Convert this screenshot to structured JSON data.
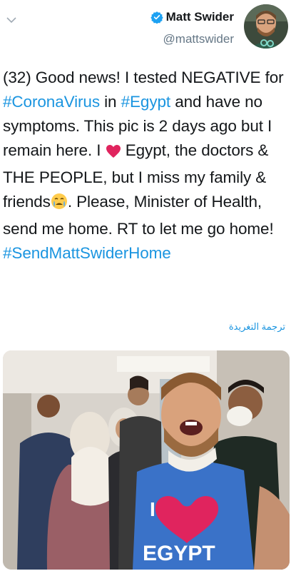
{
  "author": {
    "display_name": "Matt Swider",
    "handle": "@mattswider",
    "verified": true
  },
  "tweet": {
    "segments": [
      {
        "text": "(32) Good news! I tested NEGATIVE for ",
        "type": "text"
      },
      {
        "text": "#CoronaVirus",
        "type": "hashtag"
      },
      {
        "text": " in ",
        "type": "text"
      },
      {
        "text": "#Egypt",
        "type": "hashtag"
      },
      {
        "text": " and have no symptoms. This pic is 2 days ago but I remain here. I ",
        "type": "text"
      },
      {
        "text": "heart-emoji",
        "type": "emoji"
      },
      {
        "text": " Egypt, the doctors & THE PEOPLE, but I miss my family & friends",
        "type": "text"
      },
      {
        "text": "crying-face-emoji",
        "type": "emoji"
      },
      {
        "text": ". Please, Minister of Health, send me home. RT to let me go home! ",
        "type": "text"
      },
      {
        "text": "#SendMattSwiderHome",
        "type": "hashtag"
      }
    ]
  },
  "translate_link": "ترجمة التغريدة",
  "photo": {
    "shirt_text": "EGYPT"
  },
  "colors": {
    "link": "#1b95e0",
    "text": "#14171a",
    "secondary": "#657786",
    "verified": "#1da1f2",
    "heart": "#e0245e"
  }
}
